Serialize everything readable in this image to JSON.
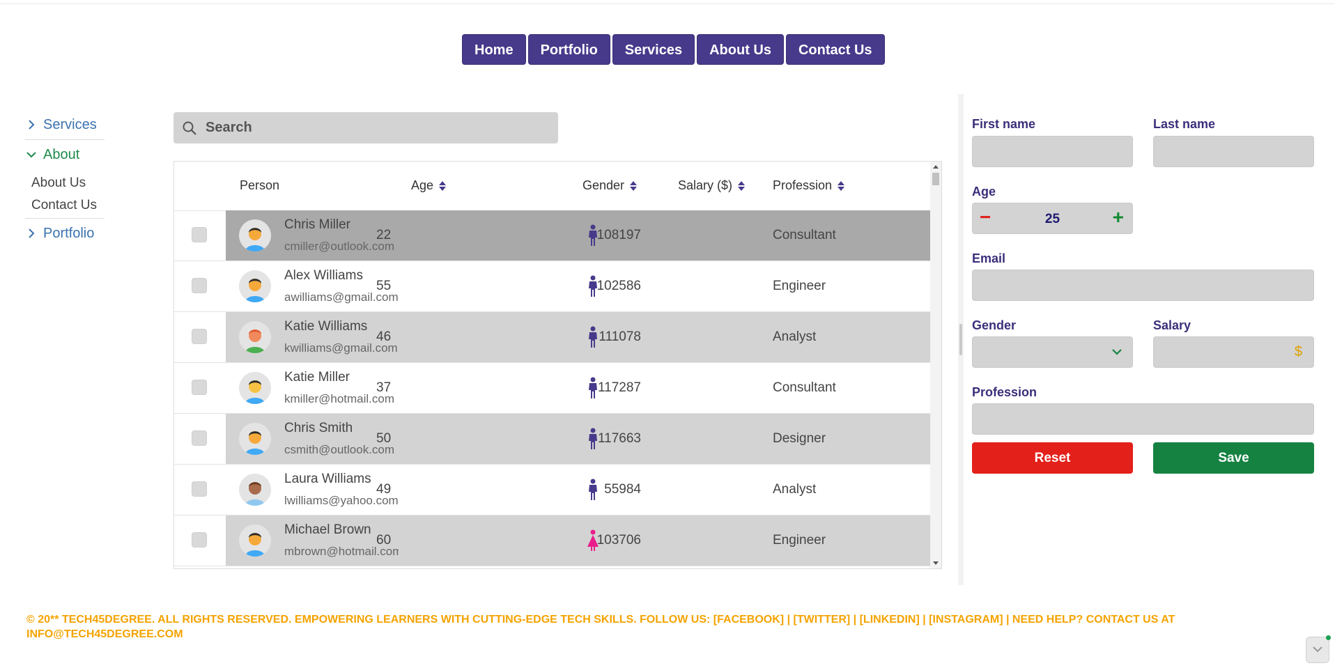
{
  "nav": {
    "items": [
      {
        "label": "Home"
      },
      {
        "label": "Portfolio"
      },
      {
        "label": "Services"
      },
      {
        "label": "About Us"
      },
      {
        "label": "Contact Us"
      }
    ]
  },
  "sidebar": {
    "services": "Services",
    "about": "About",
    "about_items": [
      "About Us",
      "Contact Us"
    ],
    "portfolio": "Portfolio"
  },
  "search": {
    "placeholder": "Search"
  },
  "table": {
    "columns": {
      "person": "Person",
      "age": "Age",
      "gender": "Gender",
      "salary": "Salary ($)",
      "profession": "Profession"
    },
    "rows": [
      {
        "name": "Chris Miller",
        "email": "cmiller@outlook.com",
        "age": "22",
        "gender": "male",
        "salary": "108197",
        "profession": "Consultant"
      },
      {
        "name": "Alex Williams",
        "email": "awilliams@gmail.com",
        "age": "55",
        "gender": "male",
        "salary": "102586",
        "profession": "Engineer"
      },
      {
        "name": "Katie Williams",
        "email": "kwilliams@gmail.com",
        "age": "46",
        "gender": "male",
        "salary": "111078",
        "profession": "Analyst"
      },
      {
        "name": "Katie Miller",
        "email": "kmiller@hotmail.com",
        "age": "37",
        "gender": "male",
        "salary": "117287",
        "profession": "Consultant"
      },
      {
        "name": "Chris Smith",
        "email": "csmith@outlook.com",
        "age": "50",
        "gender": "male",
        "salary": "117663",
        "profession": "Designer"
      },
      {
        "name": "Laura Williams",
        "email": "lwilliams@yahoo.com",
        "age": "49",
        "gender": "male",
        "salary": "55984",
        "profession": "Analyst"
      },
      {
        "name": "Michael Brown",
        "email": "mbrown@hotmail.com",
        "age": "60",
        "gender": "female",
        "salary": "103706",
        "profession": "Engineer"
      }
    ]
  },
  "form": {
    "first_name_label": "First name",
    "last_name_label": "Last name",
    "age_label": "Age",
    "age_value": "25",
    "email_label": "Email",
    "gender_label": "Gender",
    "salary_label": "Salary",
    "salary_symbol": "$",
    "profession_label": "Profession",
    "reset_label": "Reset",
    "save_label": "Save"
  },
  "footer": {
    "text": "© 20** TECH45DEGREE. ALL RIGHTS RESERVED. EMPOWERING LEARNERS WITH CUTTING-EDGE TECH SKILLS. FOLLOW US: [FACEBOOK] | [TWITTER] | [LINKEDIN] | [INSTAGRAM] | NEED HELP? CONTACT US AT INFO@TECH45DEGREE.COM"
  },
  "colors": {
    "nav_bg": "#473a8b",
    "male_icon": "#473a8b",
    "female_icon": "#e91e8c",
    "footer_text": "#f4a300",
    "reset": "#e3201a",
    "save": "#168242"
  }
}
